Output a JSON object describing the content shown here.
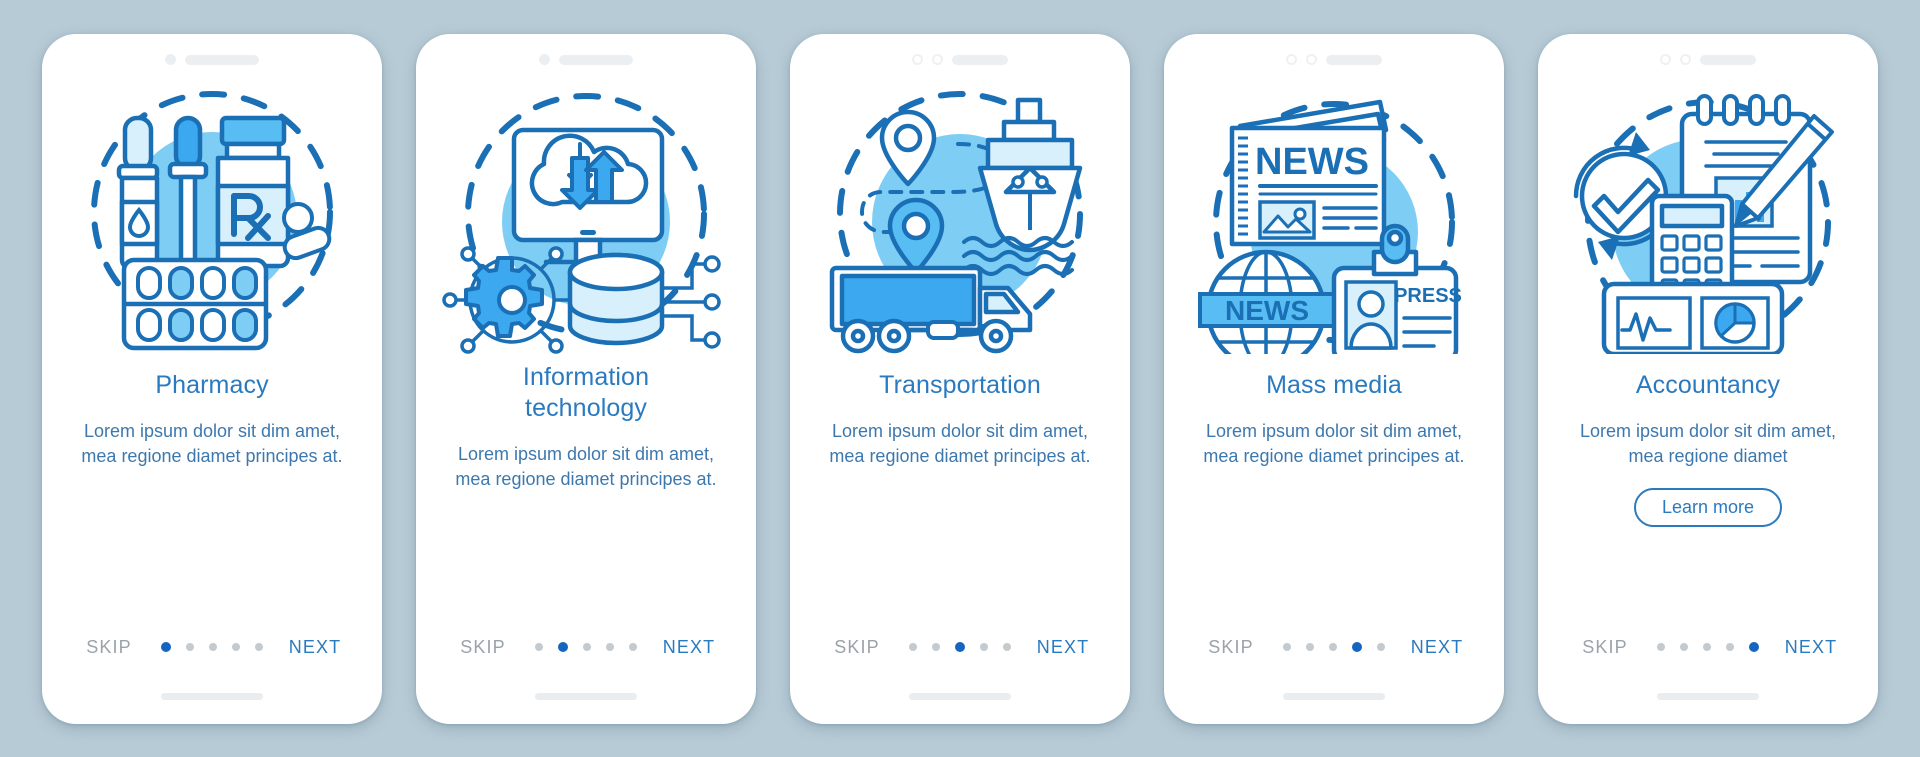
{
  "background_color": "#b7cbd6",
  "theme": {
    "accent": "#2a7ac0",
    "title_color": "#2a7ac0",
    "body_color": "#3c78ae",
    "skip_color": "#9aa3a8",
    "dot_active": "#1565c0",
    "dot_inactive": "#c4cace",
    "card_background": "#ffffff",
    "illustration_blue": "#1a6fb5",
    "illustration_fill": "#7ecdf5",
    "illustration_tint": "#d8f0fb"
  },
  "nav": {
    "skip_label": "SKIP",
    "next_label": "NEXT",
    "total_steps": 5
  },
  "screens": [
    {
      "id": "pharmacy",
      "title": "Pharmacy",
      "title_lines": [
        "Pharmacy"
      ],
      "description": "Lorem ipsum dolor sit dim amet, mea regione diamet principes at.",
      "active_step": 1,
      "cta": null,
      "illustration": "pharmacy-illustration",
      "illustration_items": [
        "dropper-bottle",
        "pipette",
        "rx-pill-bottle",
        "pills",
        "blister-pack",
        "dashed-circle"
      ]
    },
    {
      "id": "information-technology",
      "title": "Information technology",
      "title_lines": [
        "Information",
        "technology"
      ],
      "description": "Lorem ipsum dolor sit dim amet, mea regione diamet principes at.",
      "active_step": 2,
      "cta": null,
      "illustration": "information-technology-illustration",
      "illustration_items": [
        "cloud-icon",
        "monitor",
        "download-arrow",
        "upload-arrow",
        "gear-icon",
        "circuit-nodes",
        "database-cylinder",
        "dashed-circle"
      ]
    },
    {
      "id": "transportation",
      "title": "Transportation",
      "title_lines": [
        "Transportation"
      ],
      "description": "Lorem ipsum dolor sit dim amet, mea regione diamet principes at.",
      "active_step": 3,
      "cta": null,
      "illustration": "transportation-illustration",
      "illustration_items": [
        "map-pin",
        "map-pin",
        "dashed-route",
        "cargo-ship",
        "waves",
        "delivery-truck",
        "dashed-circle"
      ]
    },
    {
      "id": "mass-media",
      "title": "Mass media",
      "title_lines": [
        "Mass media"
      ],
      "description": "Lorem ipsum dolor sit dim amet, mea regione diamet principes at.",
      "active_step": 4,
      "cta": null,
      "illustration": "mass-media-illustration",
      "illustration_labels": [
        "NEWS",
        "NEWS",
        "PRESS"
      ],
      "illustration_items": [
        "newspaper",
        "globe-icon",
        "press-badge",
        "dashed-circle"
      ]
    },
    {
      "id": "accountancy",
      "title": "Accountancy",
      "title_lines": [
        "Accountancy"
      ],
      "description": "Lorem ipsum dolor sit dim amet, mea regione diamet",
      "active_step": 5,
      "cta": "Learn more",
      "illustration": "accountancy-illustration",
      "illustration_items": [
        "check-circle-arrows",
        "notepad",
        "bar-chart",
        "pencil-icon",
        "calculator-icon",
        "line-chart-panel",
        "pie-chart-panel",
        "dashed-circle"
      ]
    }
  ]
}
